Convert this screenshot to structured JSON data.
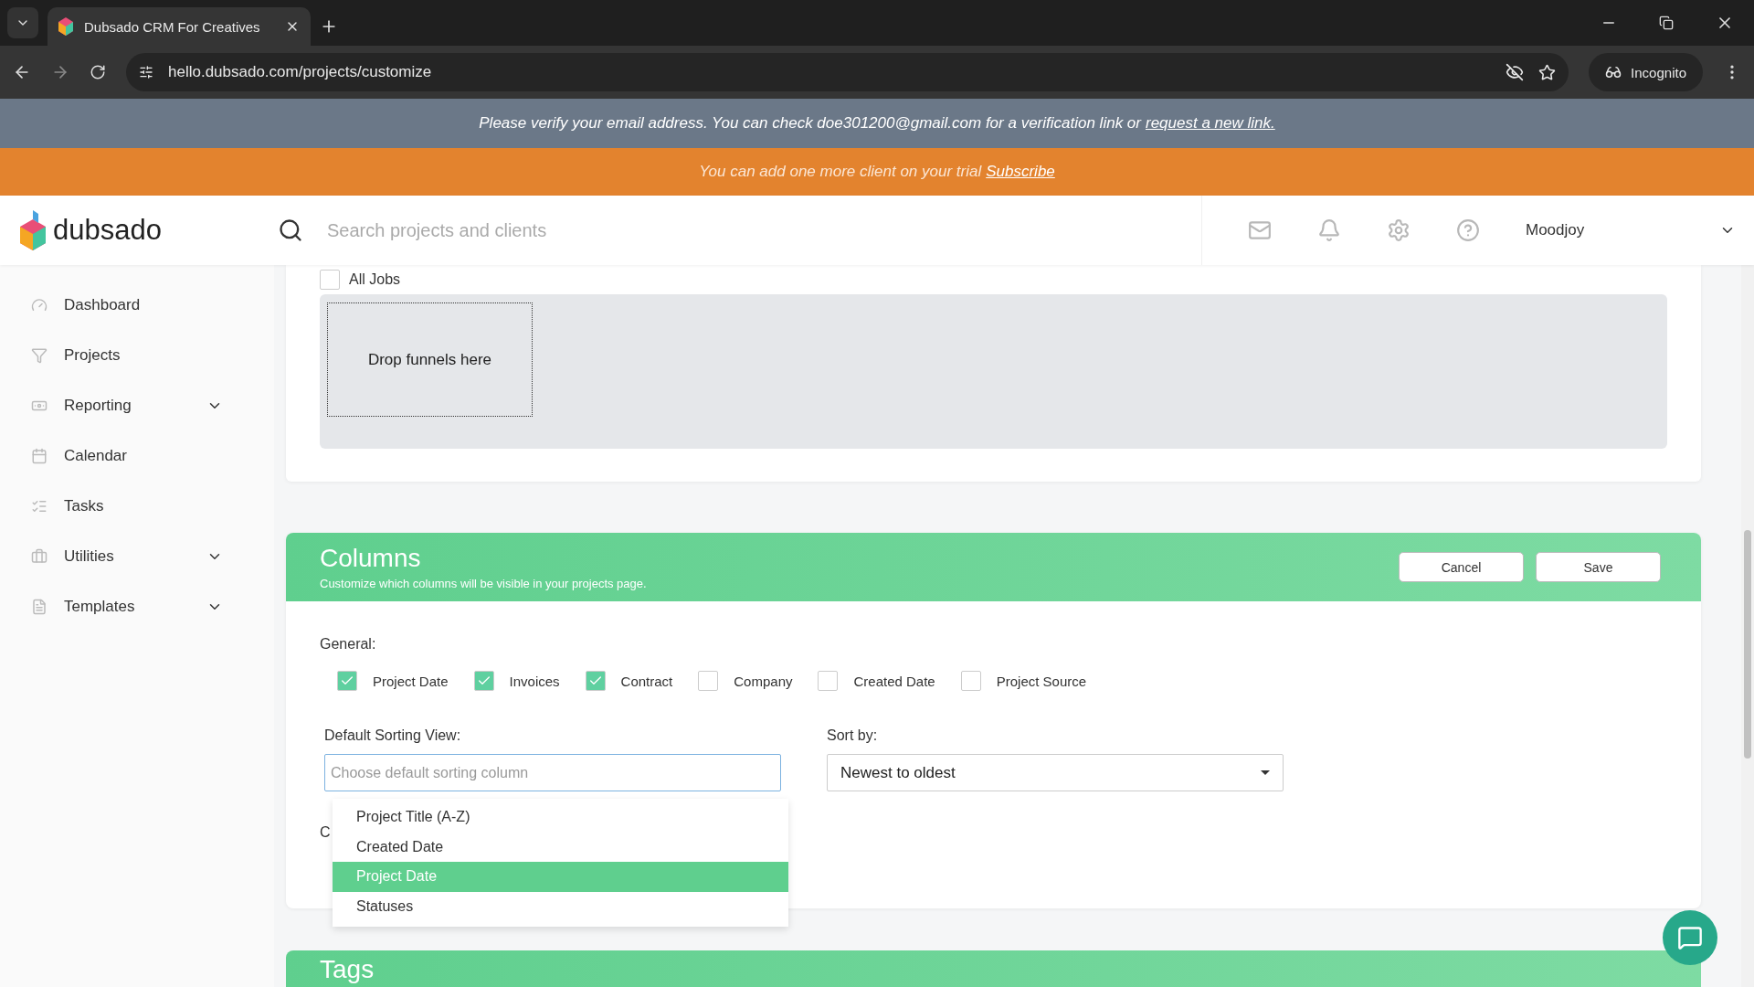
{
  "browser": {
    "tab_title": "Dubsado CRM For Creatives",
    "url": "hello.dubsado.com/projects/customize",
    "profile": "Incognito"
  },
  "verify_banner": {
    "text": "Please verify your email address. You can check doe301200@gmail.com for a verification link or",
    "link": "request a new link."
  },
  "trial_banner": {
    "text": "You can add one more client on your trial",
    "link": "Subscribe"
  },
  "header": {
    "logo": "dubsado",
    "search": {
      "placeholder": "Search projects and clients"
    },
    "user": "Moodjoy"
  },
  "sidebar": {
    "items": [
      {
        "label": "Dashboard",
        "expandable": false
      },
      {
        "label": "Projects",
        "expandable": false
      },
      {
        "label": "Reporting",
        "expandable": true
      },
      {
        "label": "Calendar",
        "expandable": false
      },
      {
        "label": "Tasks",
        "expandable": false
      },
      {
        "label": "Utilities",
        "expandable": true
      },
      {
        "label": "Templates",
        "expandable": true
      }
    ]
  },
  "funnels": {
    "all_jobs": {
      "label": "All Jobs",
      "checked": false
    },
    "drop_zone": "Drop funnels here"
  },
  "columns": {
    "title": "Columns",
    "subtitle": "Customize which columns will be visible in your projects page.",
    "buttons": [
      "Cancel",
      "Save"
    ],
    "general_label": "General:",
    "options": [
      {
        "label": "Project Date",
        "checked": true
      },
      {
        "label": "Invoices",
        "checked": true
      },
      {
        "label": "Contract",
        "checked": true
      },
      {
        "label": "Company",
        "checked": false
      },
      {
        "label": "Created Date",
        "checked": false
      },
      {
        "label": "Project Source",
        "checked": false
      }
    ],
    "sorting_label": "Default Sorting View:",
    "sorting_field": {
      "placeholder": "Choose default sorting column"
    },
    "sorting_options": [
      {
        "label": "Project Title (A-Z)",
        "selected": false
      },
      {
        "label": "Created Date",
        "selected": false
      },
      {
        "label": "Project Date",
        "selected": true
      },
      {
        "label": "Statuses",
        "selected": false
      }
    ],
    "hidden_label": "C",
    "sort_by_label": "Sort by:",
    "sort_by_value": "Newest to oldest"
  },
  "tags": {
    "title": "Tags"
  }
}
